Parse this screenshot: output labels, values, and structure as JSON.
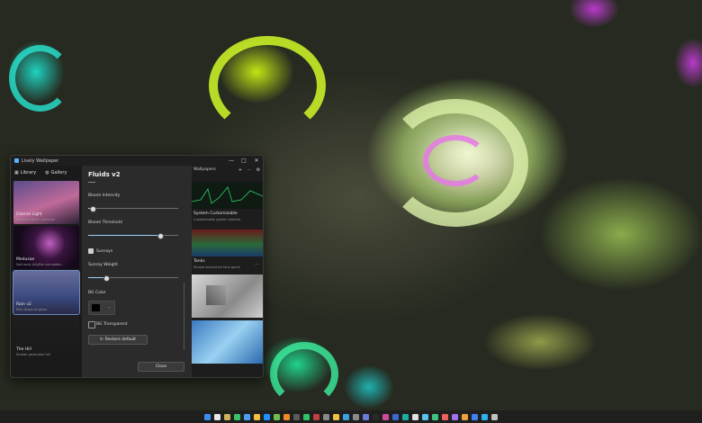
{
  "window": {
    "title": "Lively Wallpaper",
    "controls": [
      "—",
      "□",
      "✕"
    ]
  },
  "sidebar": {
    "tabs": [
      {
        "label": "Library",
        "icon": "grid-icon"
      },
      {
        "label": "Gallery",
        "icon": "globe-icon"
      }
    ],
    "items": [
      {
        "title": "Eternal Light",
        "subtitle": "Rotating lights, particles"
      },
      {
        "title": "Medusae",
        "subtitle": "Soft body jellyfish simulation"
      },
      {
        "title": "Rain v2",
        "subtitle": "Rain drops on glass"
      },
      {
        "title": "The Hill",
        "subtitle": "Shader generated hill"
      }
    ]
  },
  "panel": {
    "title": "Fluids v2",
    "bloom_intensity": {
      "label": "Bloom Intensity",
      "value": 0.05
    },
    "bloom_threshold": {
      "label": "Bloom Threshold",
      "value": 0.8
    },
    "sunrays": {
      "label": "Sunrays",
      "checked": true
    },
    "sunray_weight": {
      "label": "Sunray Weight",
      "value": 0.2
    },
    "bg_color": {
      "label": "BG Color",
      "value": "#000000"
    },
    "bg_transparent": {
      "label": "BG Transparent",
      "checked": false
    },
    "restore_label": "Restore default",
    "close_label": "Close"
  },
  "gallery": {
    "header": "Wallpapers",
    "items": [
      {
        "title": "System Customizable",
        "subtitle": "Customizable system monitor"
      },
      {
        "title": "Tanks",
        "subtitle": "Simple interactive tank game"
      }
    ]
  },
  "taskbar": {
    "icon_colors": [
      "#3b8ff0",
      "#e8e8e8",
      "#c9b25a",
      "#36c26b",
      "#4aa0f0",
      "#f0c040",
      "#1e90ff",
      "#6fbf4a",
      "#f08a24",
      "#5a5a5a",
      "#2fc16a",
      "#c04040",
      "#888888",
      "#f0c040",
      "#3aa0e0",
      "#8a8a8a",
      "#6c7ad8",
      "#2a2a2a",
      "#d04a9a",
      "#3a6ad0",
      "#1ab0a0",
      "#e0e0e0",
      "#5ac0f0",
      "#40c080",
      "#f06060",
      "#a070f0",
      "#f0a040",
      "#4080f0",
      "#30b0f0",
      "#c0c0c0"
    ]
  }
}
